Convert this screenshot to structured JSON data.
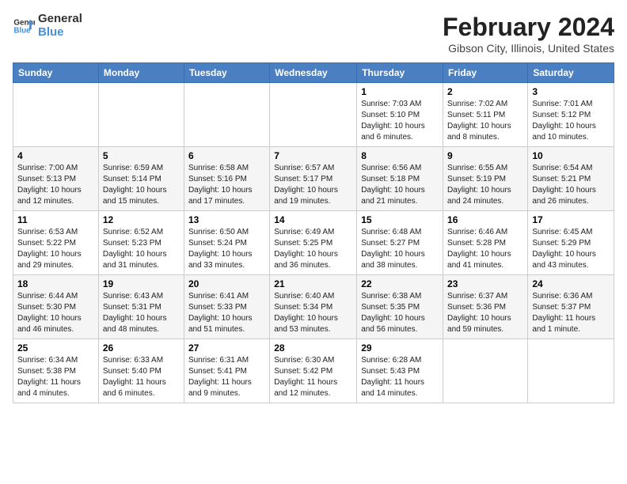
{
  "logo": {
    "line1": "General",
    "line2": "Blue"
  },
  "title": "February 2024",
  "subtitle": "Gibson City, Illinois, United States",
  "headers": [
    "Sunday",
    "Monday",
    "Tuesday",
    "Wednesday",
    "Thursday",
    "Friday",
    "Saturday"
  ],
  "weeks": [
    [
      {
        "day": "",
        "info": ""
      },
      {
        "day": "",
        "info": ""
      },
      {
        "day": "",
        "info": ""
      },
      {
        "day": "",
        "info": ""
      },
      {
        "day": "1",
        "info": "Sunrise: 7:03 AM\nSunset: 5:10 PM\nDaylight: 10 hours\nand 6 minutes."
      },
      {
        "day": "2",
        "info": "Sunrise: 7:02 AM\nSunset: 5:11 PM\nDaylight: 10 hours\nand 8 minutes."
      },
      {
        "day": "3",
        "info": "Sunrise: 7:01 AM\nSunset: 5:12 PM\nDaylight: 10 hours\nand 10 minutes."
      }
    ],
    [
      {
        "day": "4",
        "info": "Sunrise: 7:00 AM\nSunset: 5:13 PM\nDaylight: 10 hours\nand 12 minutes."
      },
      {
        "day": "5",
        "info": "Sunrise: 6:59 AM\nSunset: 5:14 PM\nDaylight: 10 hours\nand 15 minutes."
      },
      {
        "day": "6",
        "info": "Sunrise: 6:58 AM\nSunset: 5:16 PM\nDaylight: 10 hours\nand 17 minutes."
      },
      {
        "day": "7",
        "info": "Sunrise: 6:57 AM\nSunset: 5:17 PM\nDaylight: 10 hours\nand 19 minutes."
      },
      {
        "day": "8",
        "info": "Sunrise: 6:56 AM\nSunset: 5:18 PM\nDaylight: 10 hours\nand 21 minutes."
      },
      {
        "day": "9",
        "info": "Sunrise: 6:55 AM\nSunset: 5:19 PM\nDaylight: 10 hours\nand 24 minutes."
      },
      {
        "day": "10",
        "info": "Sunrise: 6:54 AM\nSunset: 5:21 PM\nDaylight: 10 hours\nand 26 minutes."
      }
    ],
    [
      {
        "day": "11",
        "info": "Sunrise: 6:53 AM\nSunset: 5:22 PM\nDaylight: 10 hours\nand 29 minutes."
      },
      {
        "day": "12",
        "info": "Sunrise: 6:52 AM\nSunset: 5:23 PM\nDaylight: 10 hours\nand 31 minutes."
      },
      {
        "day": "13",
        "info": "Sunrise: 6:50 AM\nSunset: 5:24 PM\nDaylight: 10 hours\nand 33 minutes."
      },
      {
        "day": "14",
        "info": "Sunrise: 6:49 AM\nSunset: 5:25 PM\nDaylight: 10 hours\nand 36 minutes."
      },
      {
        "day": "15",
        "info": "Sunrise: 6:48 AM\nSunset: 5:27 PM\nDaylight: 10 hours\nand 38 minutes."
      },
      {
        "day": "16",
        "info": "Sunrise: 6:46 AM\nSunset: 5:28 PM\nDaylight: 10 hours\nand 41 minutes."
      },
      {
        "day": "17",
        "info": "Sunrise: 6:45 AM\nSunset: 5:29 PM\nDaylight: 10 hours\nand 43 minutes."
      }
    ],
    [
      {
        "day": "18",
        "info": "Sunrise: 6:44 AM\nSunset: 5:30 PM\nDaylight: 10 hours\nand 46 minutes."
      },
      {
        "day": "19",
        "info": "Sunrise: 6:43 AM\nSunset: 5:31 PM\nDaylight: 10 hours\nand 48 minutes."
      },
      {
        "day": "20",
        "info": "Sunrise: 6:41 AM\nSunset: 5:33 PM\nDaylight: 10 hours\nand 51 minutes."
      },
      {
        "day": "21",
        "info": "Sunrise: 6:40 AM\nSunset: 5:34 PM\nDaylight: 10 hours\nand 53 minutes."
      },
      {
        "day": "22",
        "info": "Sunrise: 6:38 AM\nSunset: 5:35 PM\nDaylight: 10 hours\nand 56 minutes."
      },
      {
        "day": "23",
        "info": "Sunrise: 6:37 AM\nSunset: 5:36 PM\nDaylight: 10 hours\nand 59 minutes."
      },
      {
        "day": "24",
        "info": "Sunrise: 6:36 AM\nSunset: 5:37 PM\nDaylight: 11 hours\nand 1 minute."
      }
    ],
    [
      {
        "day": "25",
        "info": "Sunrise: 6:34 AM\nSunset: 5:38 PM\nDaylight: 11 hours\nand 4 minutes."
      },
      {
        "day": "26",
        "info": "Sunrise: 6:33 AM\nSunset: 5:40 PM\nDaylight: 11 hours\nand 6 minutes."
      },
      {
        "day": "27",
        "info": "Sunrise: 6:31 AM\nSunset: 5:41 PM\nDaylight: 11 hours\nand 9 minutes."
      },
      {
        "day": "28",
        "info": "Sunrise: 6:30 AM\nSunset: 5:42 PM\nDaylight: 11 hours\nand 12 minutes."
      },
      {
        "day": "29",
        "info": "Sunrise: 6:28 AM\nSunset: 5:43 PM\nDaylight: 11 hours\nand 14 minutes."
      },
      {
        "day": "",
        "info": ""
      },
      {
        "day": "",
        "info": ""
      }
    ]
  ]
}
